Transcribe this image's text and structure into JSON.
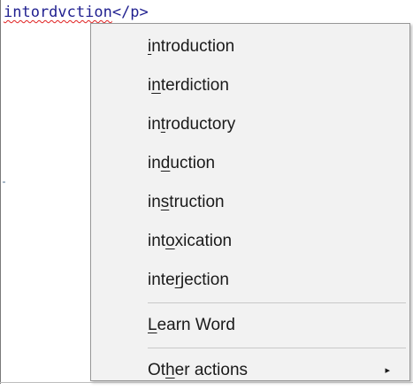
{
  "editor": {
    "misspelled_word": "intordvction",
    "closing_tag": "</p>"
  },
  "menu": {
    "suggestions": [
      {
        "pre": "",
        "mnemonic": "i",
        "post": "ntroduction"
      },
      {
        "pre": "i",
        "mnemonic": "n",
        "post": "terdiction"
      },
      {
        "pre": "in",
        "mnemonic": "t",
        "post": "roductory"
      },
      {
        "pre": "in",
        "mnemonic": "d",
        "post": "uction"
      },
      {
        "pre": "in",
        "mnemonic": "s",
        "post": "truction"
      },
      {
        "pre": "int",
        "mnemonic": "o",
        "post": "xication"
      },
      {
        "pre": "inte",
        "mnemonic": "r",
        "post": "jection"
      }
    ],
    "learn_word": {
      "pre": "",
      "mnemonic": "L",
      "post": "earn Word"
    },
    "other_actions": {
      "pre": "Ot",
      "mnemonic": "h",
      "post": "er actions"
    },
    "submenu_arrow": "▸"
  },
  "colors": {
    "menu_background": "#f2f2f2",
    "menu_border": "#979797",
    "squiggle": "#e02020",
    "code_text": "#1f1f8f"
  }
}
